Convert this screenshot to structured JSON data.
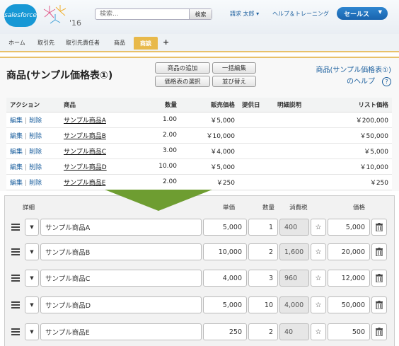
{
  "header": {
    "logo_text": "salesforce",
    "year_badge": "'16",
    "search": {
      "placeholder": "検索...",
      "button_label": "検索"
    },
    "user_menu_label": "請求 太郎 ▾",
    "help_link_label": "ヘルプ＆トレーニング",
    "app_menu_label": "セールス"
  },
  "tabs": [
    "ホーム",
    "取引先",
    "取引先責任者",
    "商品"
  ],
  "active_tab": "商談",
  "related_list": {
    "title": "商品(サンプル価格表①)",
    "buttons": {
      "add_product": "商品の追加",
      "edit_all": "一括編集",
      "choose_price_book": "価格表の選択",
      "sort": "並び替え"
    },
    "help_line1": "商品(サンプル価格表①)",
    "help_line2": "のヘルプ",
    "columns": [
      "アクション",
      "商品",
      "数量",
      "販売価格",
      "提供日",
      "明細説明",
      "リスト価格"
    ],
    "action_edit": "編集",
    "action_sep": "|",
    "action_delete": "削除",
    "rows": [
      {
        "product": "サンプル商品A",
        "qty": "1.00",
        "sales_price": "￥5,000",
        "service_date": "",
        "description": "",
        "list_price": "￥200,000"
      },
      {
        "product": "サンプル商品B",
        "qty": "2.00",
        "sales_price": "￥10,000",
        "service_date": "",
        "description": "",
        "list_price": "￥50,000"
      },
      {
        "product": "サンプル商品C",
        "qty": "3.00",
        "sales_price": "￥4,000",
        "service_date": "",
        "description": "",
        "list_price": "￥5,000"
      },
      {
        "product": "サンプル商品D",
        "qty": "10.00",
        "sales_price": "￥5,000",
        "service_date": "",
        "description": "",
        "list_price": "￥10,000"
      },
      {
        "product": "サンプル商品E",
        "qty": "2.00",
        "sales_price": "￥250",
        "service_date": "",
        "description": "",
        "list_price": "￥250"
      }
    ]
  },
  "editor": {
    "headers": {
      "detail": "詳細",
      "unit_price": "単価",
      "qty": "数量",
      "tax": "消費税",
      "price": "価格"
    },
    "rows": [
      {
        "name": "サンプル商品A",
        "unit_price": "5,000",
        "qty": "1",
        "tax": "400",
        "price": "5,000"
      },
      {
        "name": "サンプル商品B",
        "unit_price": "10,000",
        "qty": "2",
        "tax": "1,600",
        "price": "20,000"
      },
      {
        "name": "サンプル商品C",
        "unit_price": "4,000",
        "qty": "3",
        "tax": "960",
        "price": "12,000"
      },
      {
        "name": "サンプル商品D",
        "unit_price": "5,000",
        "qty": "10",
        "tax": "4,000",
        "price": "50,000"
      },
      {
        "name": "サンプル商品E",
        "unit_price": "250",
        "qty": "2",
        "tax": "40",
        "price": "500"
      }
    ]
  },
  "colors": {
    "accent": "#e8b94a",
    "link": "#1b5f9e",
    "arrow": "#6e9d31",
    "app_button": "#1963ad"
  }
}
